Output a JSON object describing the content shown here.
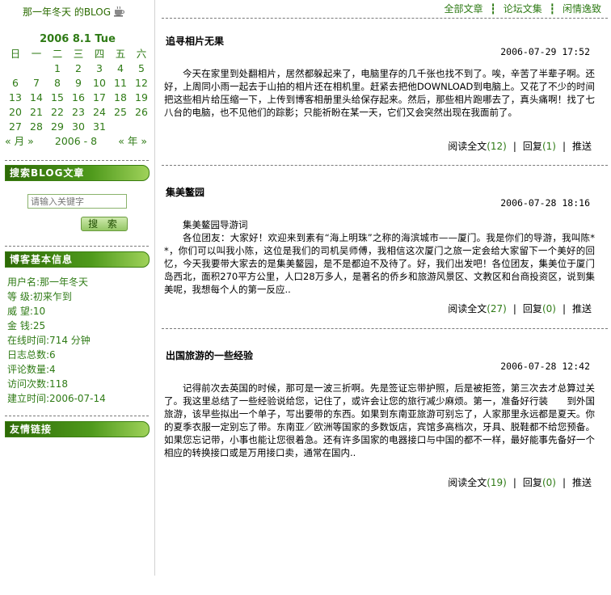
{
  "sidebar": {
    "blog_title": "那一年冬天 的BLOG",
    "calendar": {
      "title": "2006 8.1 Tue",
      "weekdays": [
        "日",
        "一",
        "二",
        "三",
        "四",
        "五",
        "六"
      ],
      "days": [
        "",
        "",
        "1",
        "2",
        "3",
        "4",
        "5",
        "6",
        "7",
        "8",
        "9",
        "10",
        "11",
        "12",
        "13",
        "14",
        "15",
        "16",
        "17",
        "18",
        "19",
        "20",
        "21",
        "22",
        "23",
        "24",
        "25",
        "26",
        "27",
        "28",
        "29",
        "30",
        "31"
      ],
      "prev_month": "« 月 »",
      "current": "2006 - 8",
      "prev_year": "« 年 »"
    },
    "search": {
      "heading": "搜索BLOG文章",
      "placeholder": "请输入关键字",
      "button": "搜 索"
    },
    "info": {
      "heading": "博客基本信息",
      "rows": [
        "用户名:那一年冬天",
        "等  级:初来乍到",
        "威  望:10",
        "金  钱:25",
        "在线时间:714 分钟",
        "日志总数:6",
        "评论数量:4",
        "访问次数:118",
        "建立时间:2006-07-14"
      ]
    },
    "links": {
      "heading": "友情链接"
    }
  },
  "nav": {
    "items": [
      "全部文章",
      "论坛文集",
      "闲情逸致"
    ],
    "separator": "┇"
  },
  "posts": [
    {
      "title": "追寻相片无果",
      "date": "2006-07-29 17:52",
      "paragraphs": [
        "今天在家里到处翻相片，居然都躲起来了，电脑里存的几千张也找不到了。唉，辛苦了半辈子啊。还好，上周同小雨一起去于山拍的相片还在相机里。赶紧去把他DOWNLOAD到电脑上。又花了不少的时间把这些相片给压缩一下，上传到博客相册里头给保存起来。然后，那些相片跑哪去了，真头痛啊！找了七八台的电脑，也不见他们的踪影；只能祈盼在某一天，它们又会突然出现在我面前了。"
      ],
      "read_label": "阅读全文",
      "read_count": "(12)",
      "reply_label": "回复",
      "reply_count": "(1)",
      "push_label": "推送"
    },
    {
      "title": "集美鳌园",
      "date": "2006-07-28 18:16",
      "paragraphs": [
        "集美鳌园导游词",
        "各位团友：大家好！欢迎来到素有“海上明珠”之称的海滨城市——厦门。我是你们的导游，我叫陈**，你们可以叫我小陈，这位是我们的司机吴师傅，我相信这次厦门之旅一定会给大家留下一个美好的回忆，今天我要带大家去的是集美鳌园，是不是都迫不及待了。好，我们出发吧！各位团友，集美位于厦门岛西北，面积270平方公里，人口28万多人，是著名的侨乡和旅游风景区、文教区和台商投资区，说到集美呢，我想每个人的第一反应.."
      ],
      "read_label": "阅读全文",
      "read_count": "(27)",
      "reply_label": "回复",
      "reply_count": "(0)",
      "push_label": "推送"
    },
    {
      "title": "出国旅游的一些经验",
      "date": "2006-07-28 12:42",
      "paragraphs": [
        "记得前次去英国的时候，那可是一波三折啊。先是签证忘带护照，后是被拒签，第三次去才总算过关了。我这里总结了一些经验说给您，记住了，或许会让您的旅行减少麻烦。第一，准备好行装　　到外国旅游，该早些拟出一个单子，写出要带的东西。如果到东南亚旅游可别忘了，人家那里永远都是夏天。你的夏季衣服一定别忘了带。东南亚／欧洲等国家的多数饭店，宾馆多高档次，牙具、脱鞋都不给您预备。如果您忘记带，小事也能让您很着急。还有许多国家的电器接口与中国的都不一样，最好能事先备好一个相应的转换接口或是万用接口卖，通常在国内.."
      ],
      "read_label": "阅读全文",
      "read_count": "(19)",
      "reply_label": "回复",
      "reply_count": "(0)",
      "push_label": "推送"
    }
  ]
}
